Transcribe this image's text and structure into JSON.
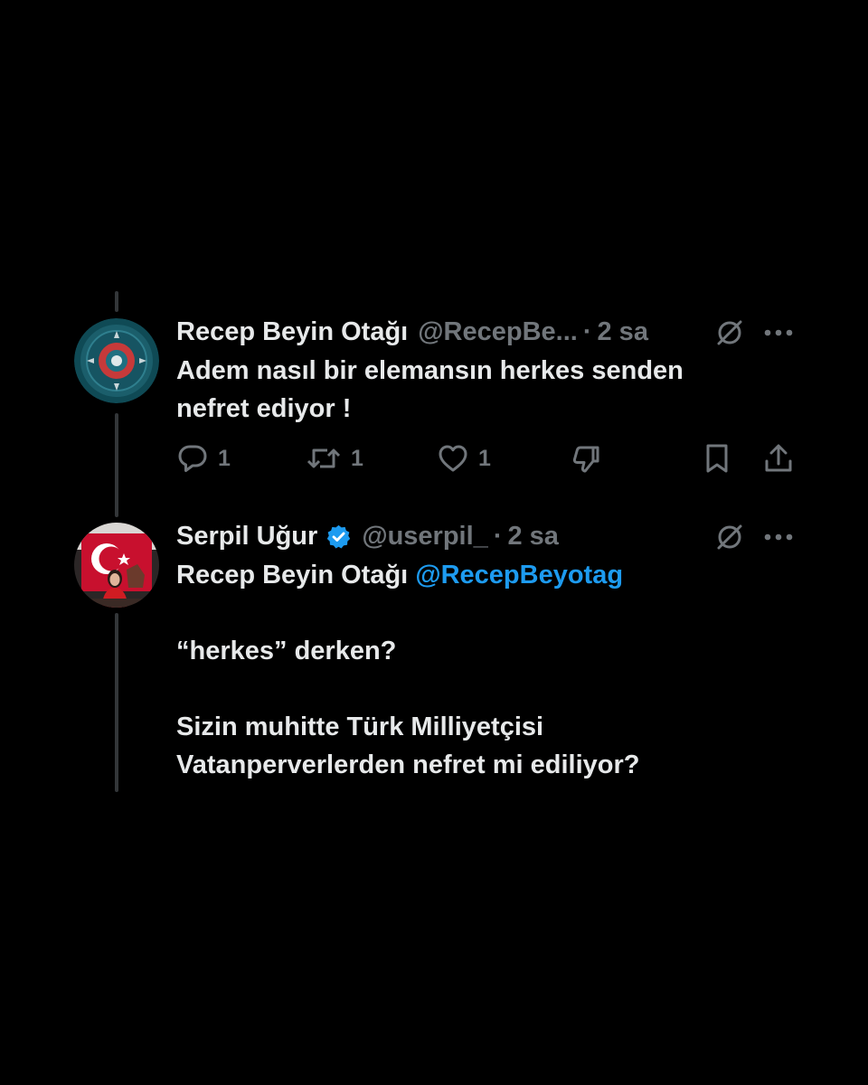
{
  "tweets": [
    {
      "name": "Recep Beyin Otağı",
      "handle": "@RecepBe...",
      "dot": "·",
      "time": "2 sa",
      "text": "Adem nasıl bir elemansın herkes senden nefret ediyor !",
      "actions": {
        "reply_count": "1",
        "retweet_count": "1",
        "like_count": "1"
      },
      "avatar_colors": [
        "#1b5e6b",
        "#0f4a55",
        "#c63a3a"
      ]
    },
    {
      "name": "Serpil Uğur",
      "verified": true,
      "handle": "@userpil_",
      "dot": "·",
      "time": "2 sa",
      "reply_to_name": "Recep Beyin Otağı",
      "reply_to_handle": "@RecepBeyotag",
      "paragraph_1": "“herkes” derken?",
      "paragraph_2": "Sizin muhitte Türk Milliyetçisi\nVatanperverlerden nefret mi ediliyor?",
      "avatar_colors": [
        "#c8102e",
        "#ffffff",
        "#3a2a25"
      ]
    }
  ],
  "colors": {
    "background": "#000000",
    "text": "#e7e9ea",
    "secondary": "#71767b",
    "link": "#1d9bf0",
    "thread_line": "#333639",
    "verified": "#1d9bf0"
  },
  "icons": [
    "grok-icon",
    "more-icon",
    "reply-icon",
    "retweet-icon",
    "like-icon",
    "dislike-icon",
    "bookmark-icon",
    "share-icon",
    "verified-badge-icon"
  ]
}
